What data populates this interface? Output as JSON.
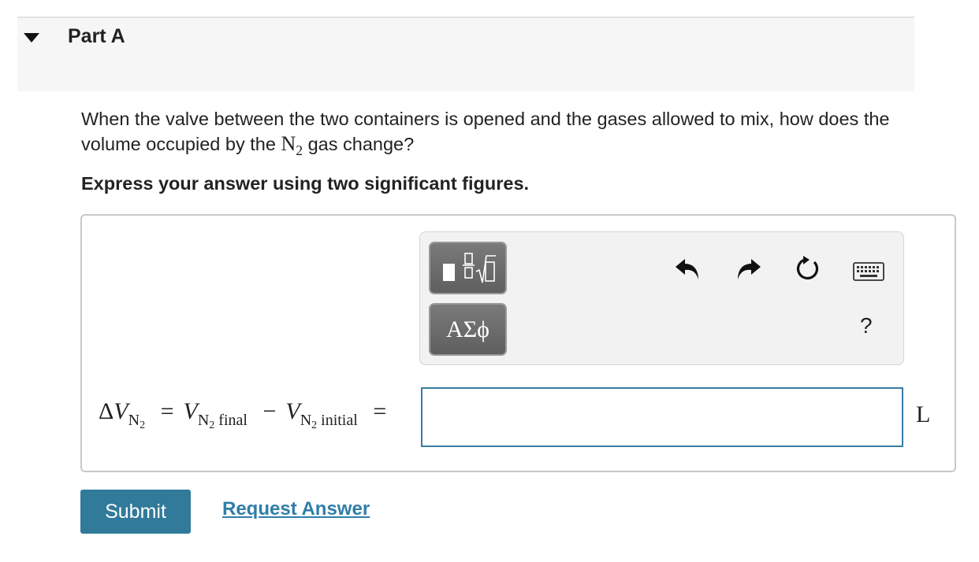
{
  "part": {
    "title": "Part A"
  },
  "question": {
    "text_before": "When the valve between the two containers is opened and the gases allowed to mix, how does the volume occupied by the ",
    "species": "N",
    "species_subscript": "2",
    "text_after": " gas change?"
  },
  "instructions": "Express your answer using two significant figures.",
  "toolbar": {
    "templates_icon": "templates-icon",
    "symbols_label": "ΑΣϕ",
    "undo_icon": "undo-icon",
    "redo_icon": "redo-icon",
    "reset_icon": "reset-icon",
    "keyboard_icon": "keyboard-icon",
    "help_label": "?"
  },
  "equation": {
    "delta": "Δ",
    "var": "V",
    "species": "N",
    "subscript": "2",
    "equals": "=",
    "final_label": "final",
    "minus": "−",
    "initial_label": "initial"
  },
  "answer": {
    "value": "",
    "placeholder": ""
  },
  "unit": "L",
  "buttons": {
    "submit": "Submit",
    "request_answer": "Request Answer"
  },
  "colors": {
    "accent": "#317a99",
    "link": "#2f7ea8",
    "input_border": "#3a7ca5"
  }
}
